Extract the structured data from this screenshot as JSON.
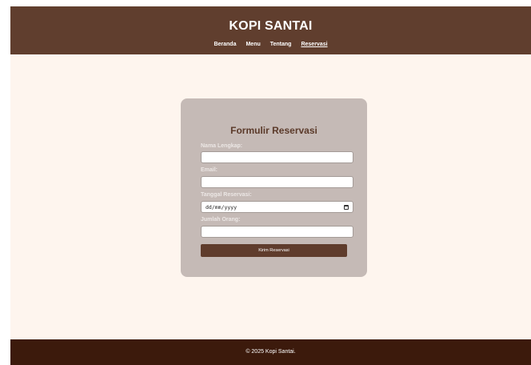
{
  "header": {
    "brand": "KOPI SANTAI",
    "nav": [
      {
        "label": "Beranda"
      },
      {
        "label": "Menu"
      },
      {
        "label": "Tentang"
      },
      {
        "label": "Reservasi",
        "active": true
      }
    ]
  },
  "form": {
    "title": "Formulir Reservasi",
    "fields": [
      {
        "label": "Nama Lengkap:",
        "value": ""
      },
      {
        "label": "Email:",
        "value": ""
      },
      {
        "label": "Tanggal Reservasi:",
        "value": "dd/mm/yyyy",
        "icon": "calendar-icon"
      },
      {
        "label": "Jumlah Orang:",
        "value": ""
      }
    ],
    "submit_label": "Kirim Reservasi"
  },
  "footer": {
    "text": "© 2025 Kopi Santai."
  },
  "colors": {
    "header_bg": "#603e2e",
    "page_bg": "#fef5ee",
    "card_bg": "#c5bab6",
    "button_bg": "#5f3c2c",
    "footer_bg": "#3c1a0c"
  }
}
